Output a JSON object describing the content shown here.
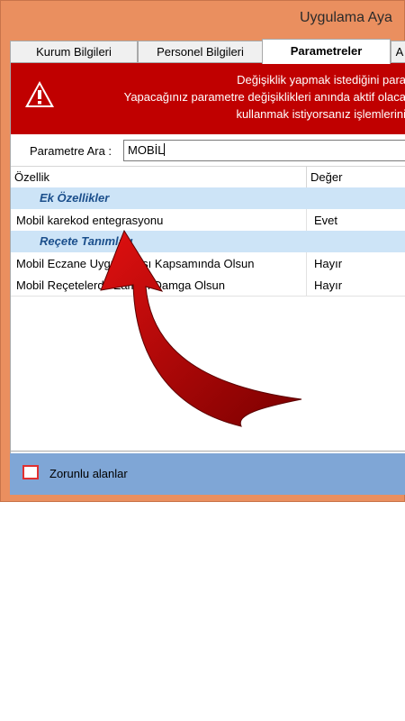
{
  "window": {
    "title": "Uygulama Aya"
  },
  "tabs": [
    {
      "label": "Kurum Bilgileri",
      "active": false
    },
    {
      "label": "Personel Bilgileri",
      "active": false
    },
    {
      "label": "Parametreler",
      "active": true
    },
    {
      "label": "A",
      "active": false
    }
  ],
  "banner": {
    "lines": [
      "Değişiklik yapmak istediğini para",
      "Yapacağınız parametre değişiklikleri anında aktif olaca",
      "kullanmak istiyorsanız işlemlerini"
    ],
    "icon": "warning-icon",
    "color": "#c00000"
  },
  "search": {
    "label": "Parametre Ara :",
    "value": "MOBİL"
  },
  "grid": {
    "headers": {
      "property": "Özellik",
      "value": "Değer"
    },
    "categories": [
      {
        "name": "Ek Özellikler",
        "rows": [
          {
            "property": "Mobil karekod entegrasyonu",
            "value": "Evet"
          }
        ]
      },
      {
        "name": "Reçete Tanımları",
        "rows": [
          {
            "property": "Mobil Eczane Uygulaması Kapsamında Olsun",
            "value": "Hayır"
          },
          {
            "property": "Mobil Reçetelerde Zaman Damga Olsun",
            "value": "Hayır"
          }
        ]
      }
    ]
  },
  "footer": {
    "required_label": "Zorunlu alanlar",
    "required_color": "#e03030"
  },
  "accent_colors": {
    "window_frame": "#ea8f5f",
    "category_bg": "#cde4f7",
    "footer_bg": "#7fa6d6",
    "annotation_arrow": "#a00000"
  }
}
